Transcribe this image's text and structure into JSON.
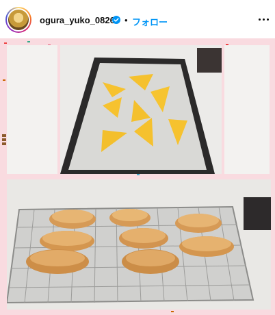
{
  "header": {
    "username": "ogura_yuko_0826",
    "separator": "•",
    "follow_label": "フォロー"
  },
  "icons": {
    "verified": "verified-badge-icon",
    "more": "more-options-icon"
  },
  "colors": {
    "follow": "#0095f6",
    "verified": "#0095f6",
    "frame": "#f9dbe0"
  }
}
